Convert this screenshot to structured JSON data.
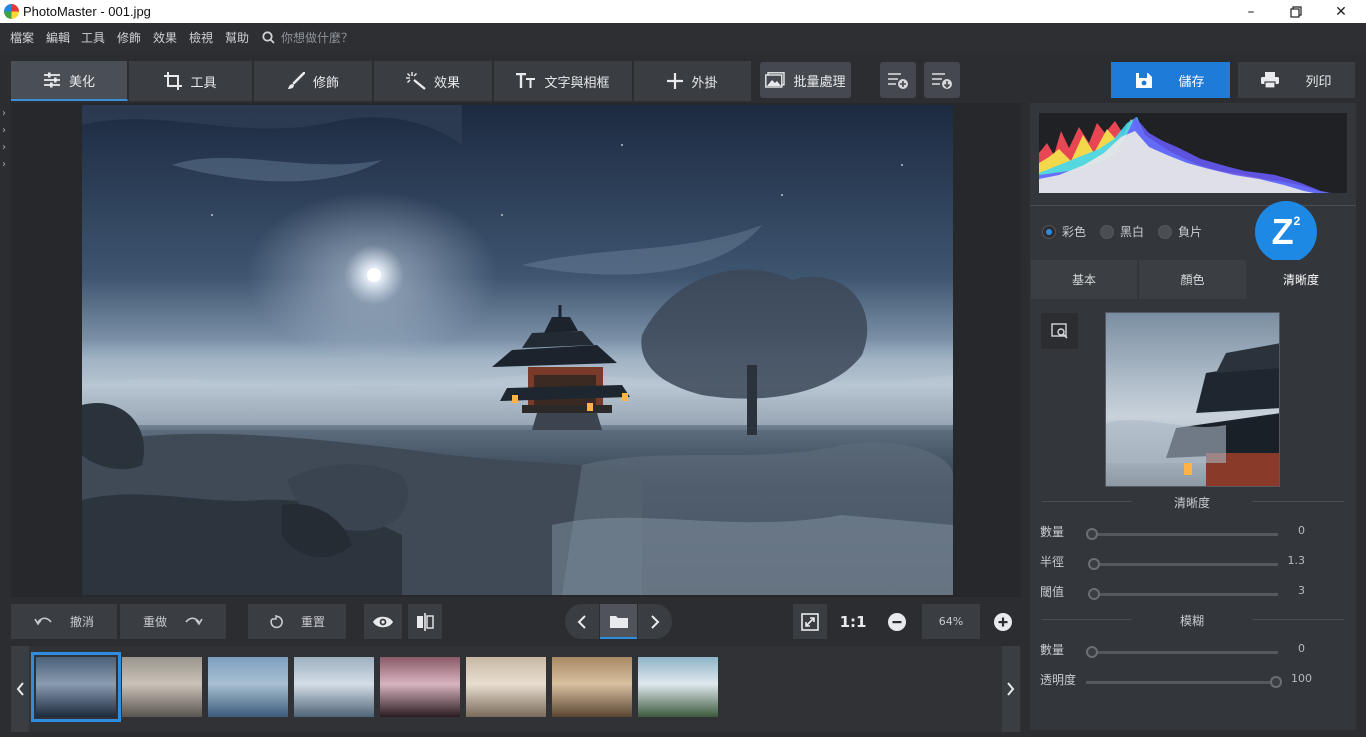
{
  "window": {
    "title": "PhotoMaster - 001.jpg"
  },
  "menu": {
    "items": [
      "檔案",
      "編輯",
      "工具",
      "修飾",
      "效果",
      "檢視",
      "幫助"
    ],
    "search_placeholder": "你想做什麼？"
  },
  "toolbar": {
    "tabs": [
      {
        "label": "美化",
        "icon": "sliders-icon"
      },
      {
        "label": "工具",
        "icon": "crop-icon"
      },
      {
        "label": "修飾",
        "icon": "brush-icon"
      },
      {
        "label": "效果",
        "icon": "magic-wand-icon"
      },
      {
        "label": "文字與相框",
        "icon": "text-icon"
      },
      {
        "label": "外掛",
        "icon": "plus-icon"
      }
    ],
    "batch_label": "批量處理",
    "save_label": "儲存",
    "print_label": "列印"
  },
  "controls": {
    "undo_label": "撤消",
    "redo_label": "重做",
    "reset_label": "重置",
    "ratio_label": "1:1",
    "zoom_value": "64%"
  },
  "filmstrip": {
    "thumbnails": [
      {
        "name": "pavilion-night",
        "colors": [
          "#1d2a3e",
          "#4a6078",
          "#8a9cb0"
        ]
      },
      {
        "name": "mountain-temple",
        "colors": [
          "#5a5550",
          "#9a958e",
          "#c9c2b8"
        ]
      },
      {
        "name": "floating-island",
        "colors": [
          "#3c5a7a",
          "#7ea0be",
          "#a8c0d2"
        ]
      },
      {
        "name": "cliff-waterfall",
        "colors": [
          "#4e6478",
          "#9eb0c0",
          "#d4dde6"
        ]
      },
      {
        "name": "twisted-tree",
        "colors": [
          "#2a1c20",
          "#8a5a68",
          "#d8b4c0"
        ]
      },
      {
        "name": "pagoda-tower",
        "colors": [
          "#7a6a5a",
          "#c8b8a4",
          "#e8ded0"
        ]
      },
      {
        "name": "desert-gate",
        "colors": [
          "#5a4532",
          "#a88a64",
          "#d8c0a0"
        ]
      },
      {
        "name": "bonsai-garden",
        "colors": [
          "#3c5a3c",
          "#8eb4c8",
          "#e0e8ee"
        ]
      }
    ]
  },
  "panel": {
    "color_modes": [
      "彩色",
      "黑白",
      "負片"
    ],
    "selected_mode": "彩色",
    "badge_letter": "Z",
    "badge_sup": "2",
    "tabs": [
      "基本",
      "顏色",
      "清晰度"
    ],
    "active_tab": "清晰度",
    "sharpen_section": "清晰度",
    "blur_section": "模糊",
    "sliders": [
      {
        "label": "數量",
        "value": "0",
        "fraction": 0.0
      },
      {
        "label": "半徑",
        "value": "1.3",
        "fraction": 0.01
      },
      {
        "label": "閾值",
        "value": "3",
        "fraction": 0.01
      },
      {
        "label": "數量",
        "value": "0",
        "fraction": 0.0
      },
      {
        "label": "透明度",
        "value": "100",
        "fraction": 1.0
      }
    ]
  }
}
